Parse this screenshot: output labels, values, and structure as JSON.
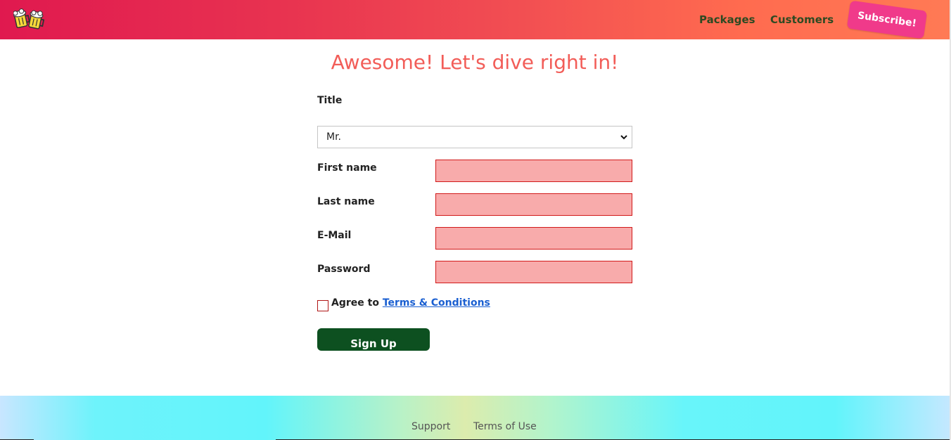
{
  "header": {
    "logo_icon": "beer-mugs-logo",
    "nav": [
      {
        "label": "Packages"
      },
      {
        "label": "Customers"
      }
    ],
    "subscribe_label": "Subscribe!",
    "colors": {
      "gradient_start": "#e0194f",
      "gradient_end": "#ff7a55",
      "nav_text": "#2d4a22",
      "subscribe_bg": "#f03a8a"
    }
  },
  "main": {
    "heading": "Awesome! Let's dive right in!",
    "title_field": {
      "label": "Title",
      "selected": "Mr.",
      "icon": "chevron-down-icon"
    },
    "fields": [
      {
        "label": "First name",
        "value": ""
      },
      {
        "label": "Last name",
        "value": ""
      },
      {
        "label": "E-Mail",
        "value": ""
      },
      {
        "label": "Password",
        "value": ""
      }
    ],
    "agree": {
      "prefix": "Agree to",
      "link": "Terms & Conditions",
      "checked": false
    },
    "signup_label": "Sign Up",
    "colors": {
      "heading": "#f25d58",
      "field_invalid_bg": "#f8abab",
      "field_invalid_border": "#d11a1a",
      "signup_bg": "#0d5020",
      "link": "#1a5fd1"
    }
  },
  "footer": {
    "links": [
      {
        "label": "Support"
      },
      {
        "label": "Terms of Use"
      }
    ]
  }
}
